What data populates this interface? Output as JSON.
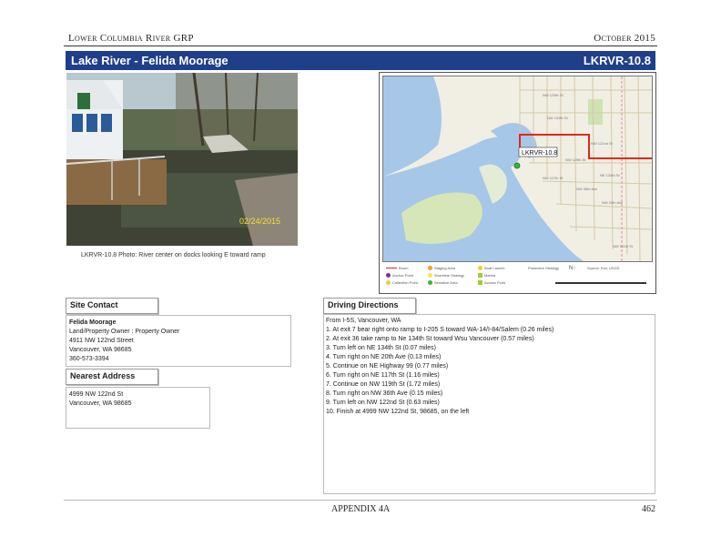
{
  "header": {
    "left": "Lower Columbia River GRP",
    "right": "October 2015"
  },
  "title_bar": {
    "title": "Lake River - Felida Moorage",
    "site_id": "LKRVR-10.8"
  },
  "photo": {
    "date_stamp": "02/24/2015",
    "caption": "LKRVR-10.8 Photo: River center on docks looking E toward ramp"
  },
  "map": {
    "site_label": "LKRVR-10.8",
    "colors": {
      "route": "#e0281e",
      "water": "#a6c7e8",
      "land": "#f1eee4",
      "green": "#d6e6b8",
      "road": "#d4c9a6"
    },
    "street_labels": [
      "NW 119th St",
      "NW 122nd St",
      "NW 117th St",
      "NW 36th Ave",
      "NW 20th Ave",
      "NE 134th St",
      "NW 125th St",
      "NW 139th St",
      "NW 111th St"
    ],
    "legend": {
      "items": [
        "Boom",
        "Anchor Point",
        "Collection Point",
        "Staging Area",
        "Shoreline Strategy",
        "Sensitive Area",
        "Boat Launch",
        "Marina",
        "Access Point",
        "Protection Strategy"
      ],
      "north": "N",
      "scale": "Source: Esri, USGS"
    }
  },
  "site_contact": {
    "heading": "Site Contact",
    "name": "Felida Moorage",
    "role": "Land/Property Owner : Property Owner",
    "street": "4911 NW 122nd Street",
    "city": "Vancouver, WA 98685",
    "phone": "360-573-3394"
  },
  "nearest_address": {
    "heading": "Nearest Address",
    "line1": "4999 NW 122nd St",
    "line2": "Vancouver, WA 98685"
  },
  "directions": {
    "heading": "Driving Directions",
    "from": "From I-5S, Vancouver, WA",
    "steps": [
      "1. At exit 7 bear right onto ramp to I-205 S toward WA-14/I-84/Salem (0.26 miles)",
      "2. At exit 36 take ramp to Ne 134th St toward Wsu Vancouver (0.57 miles)",
      "3. Turn left on NE 134th St (0.07 miles)",
      "4. Turn right on NE 20th Ave (0.13 miles)",
      "5. Continue on NE Highway 99 (0.77 miles)",
      "6. Turn right on NE 117th St (1.16 miles)",
      "7. Continue on NW 119th St (1.72 miles)",
      "8. Turn right on NW 36th Ave (0.15 miles)",
      "9. Turn left on NW 122nd St (0.63 miles)",
      "10. Finish at 4999 NW 122nd St, 98685, on the left"
    ]
  },
  "footer": {
    "center": "APPENDIX 4A",
    "page": "462"
  }
}
